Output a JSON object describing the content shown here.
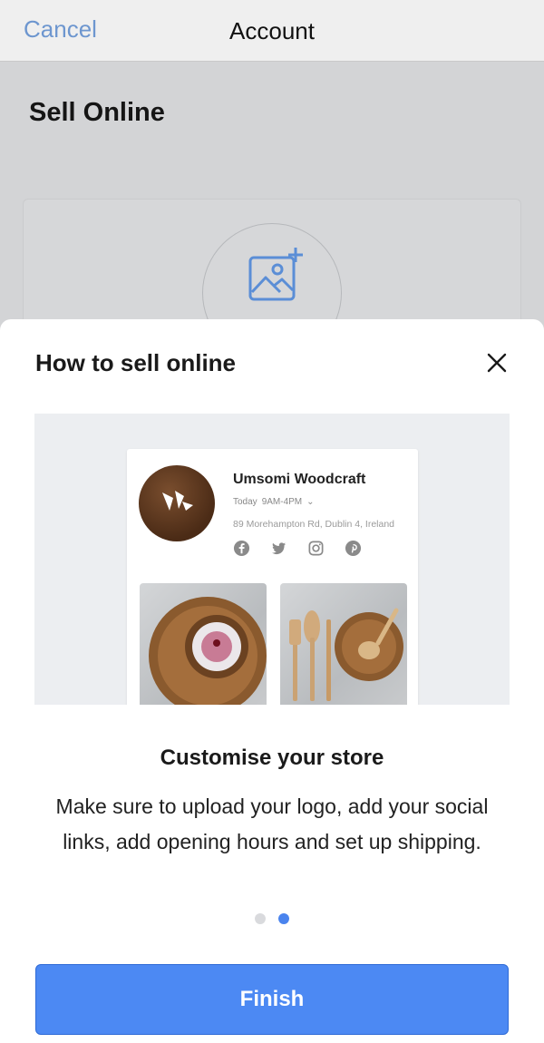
{
  "navbar": {
    "cancel_label": "Cancel",
    "title": "Account"
  },
  "page": {
    "title": "Sell Online",
    "upload_icon": "add-image-icon"
  },
  "sheet": {
    "title": "How to sell online",
    "close_icon": "close-icon",
    "preview": {
      "store_name": "Umsomi Woodcraft",
      "hours_day": "Today",
      "hours_time": "9AM-4PM",
      "address": "89 Morehampton Rd, Dublin 4, Ireland",
      "social_icons": [
        "facebook-icon",
        "twitter-icon",
        "instagram-icon",
        "pinterest-icon"
      ]
    },
    "heading": "Customise your store",
    "body": "Make sure to upload your logo, add your social links, add opening hours and set up shipping.",
    "pagination": {
      "total": 2,
      "current": 2
    },
    "finish_label": "Finish"
  },
  "colors": {
    "accent": "#4c89f3",
    "link": "#6d96cf",
    "dot_active": "#4a84ee",
    "dot_inactive": "#d9dadd"
  }
}
